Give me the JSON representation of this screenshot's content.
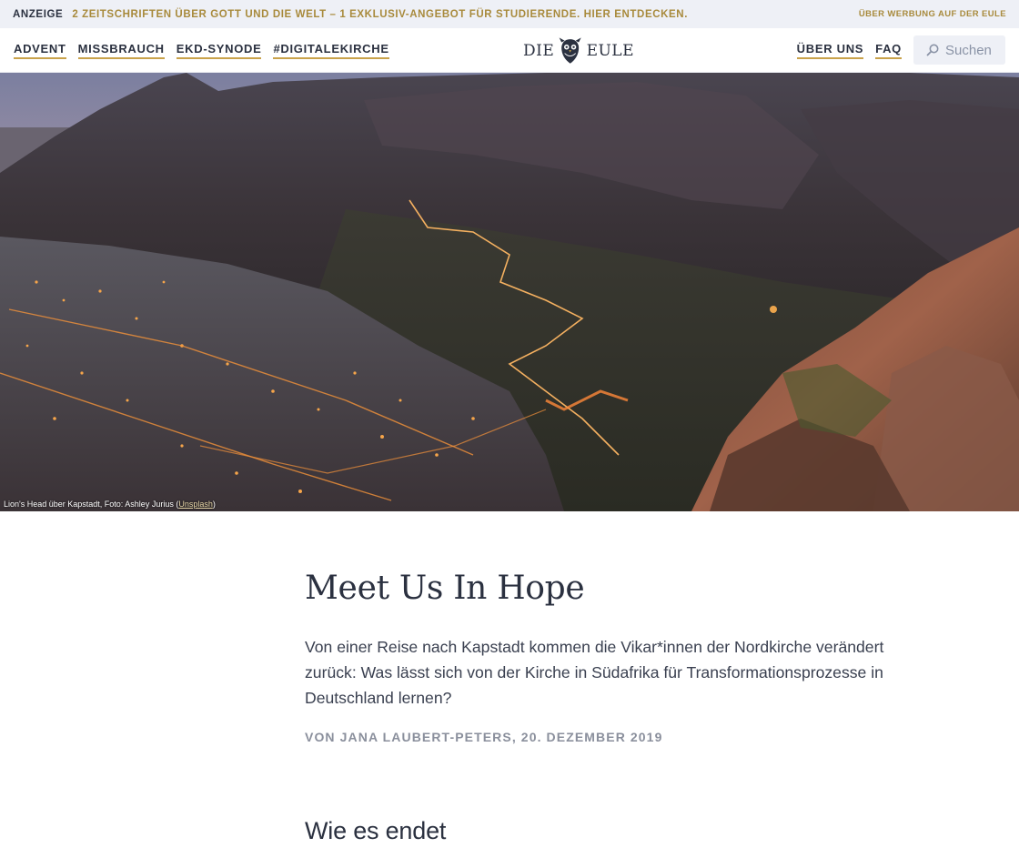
{
  "adbar": {
    "tag": "ANZEIGE",
    "promo": "2 ZEITSCHRIFTEN ÜBER GOTT UND DIE WELT – 1 EXKLUSIV-ANGEBOT FÜR STUDIERENDE. HIER ENTDECKEN.",
    "promo_right": "ÜBER WERBUNG AUF DER EULE"
  },
  "nav": {
    "left": [
      "ADVENT",
      "MISSBRAUCH",
      "EKD-SYNODE",
      "#DIGITALEKIRCHE"
    ],
    "logo_left": "DIE",
    "logo_right": "EULE",
    "right": [
      "ÜBER UNS",
      "FAQ"
    ],
    "search_placeholder": "Suchen"
  },
  "hero": {
    "caption_prefix": "Lion's Head über Kapstadt, Foto: Ashley Jurius (",
    "caption_link": "Unsplash",
    "caption_suffix": ")"
  },
  "article": {
    "title": "Meet Us In Hope",
    "lead": "Von einer Reise nach Kapstadt kommen die Vikar*innen der Nordkirche verändert zurück: Was lässt sich von der Kirche in Südafrika für Transformationsprozesse in Deutschland lernen?",
    "byline_prefix": "VON ",
    "author": "JANA LAUBERT-PETERS",
    "date": ", 20. DEZEMBER 2019",
    "subhead": "Wie es endet"
  },
  "colors": {
    "accent": "#c9a24a",
    "text": "#2b3140",
    "adbar_bg": "#eef0f6"
  }
}
